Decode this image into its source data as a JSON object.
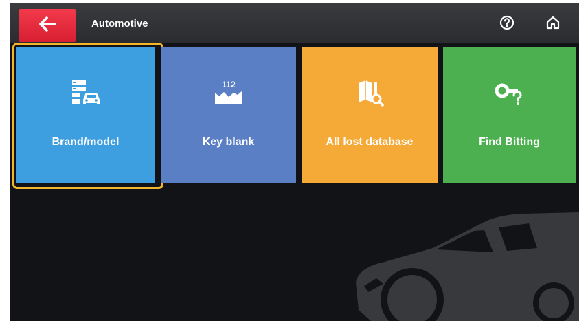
{
  "header": {
    "title": "Automotive",
    "back_icon": "arrow-left-icon",
    "help_icon": "question-circle-icon",
    "home_icon": "home-icon"
  },
  "tiles": [
    {
      "label": "Brand/model",
      "icon": "car-database-icon",
      "color": "#3d9fe0",
      "selected": true
    },
    {
      "label": "Key blank",
      "icon": "key-blank-icon",
      "icon_text": "112",
      "color": "#5b7fc4",
      "selected": false
    },
    {
      "label": "All lost database",
      "icon": "book-search-icon",
      "color": "#f5a937",
      "selected": false
    },
    {
      "label": "Find Bitting",
      "icon": "key-question-icon",
      "color": "#4caf50",
      "selected": false
    }
  ],
  "colors": {
    "back_button": "#e52a3c",
    "focus_border": "#f3b62b",
    "background": "#121316"
  }
}
